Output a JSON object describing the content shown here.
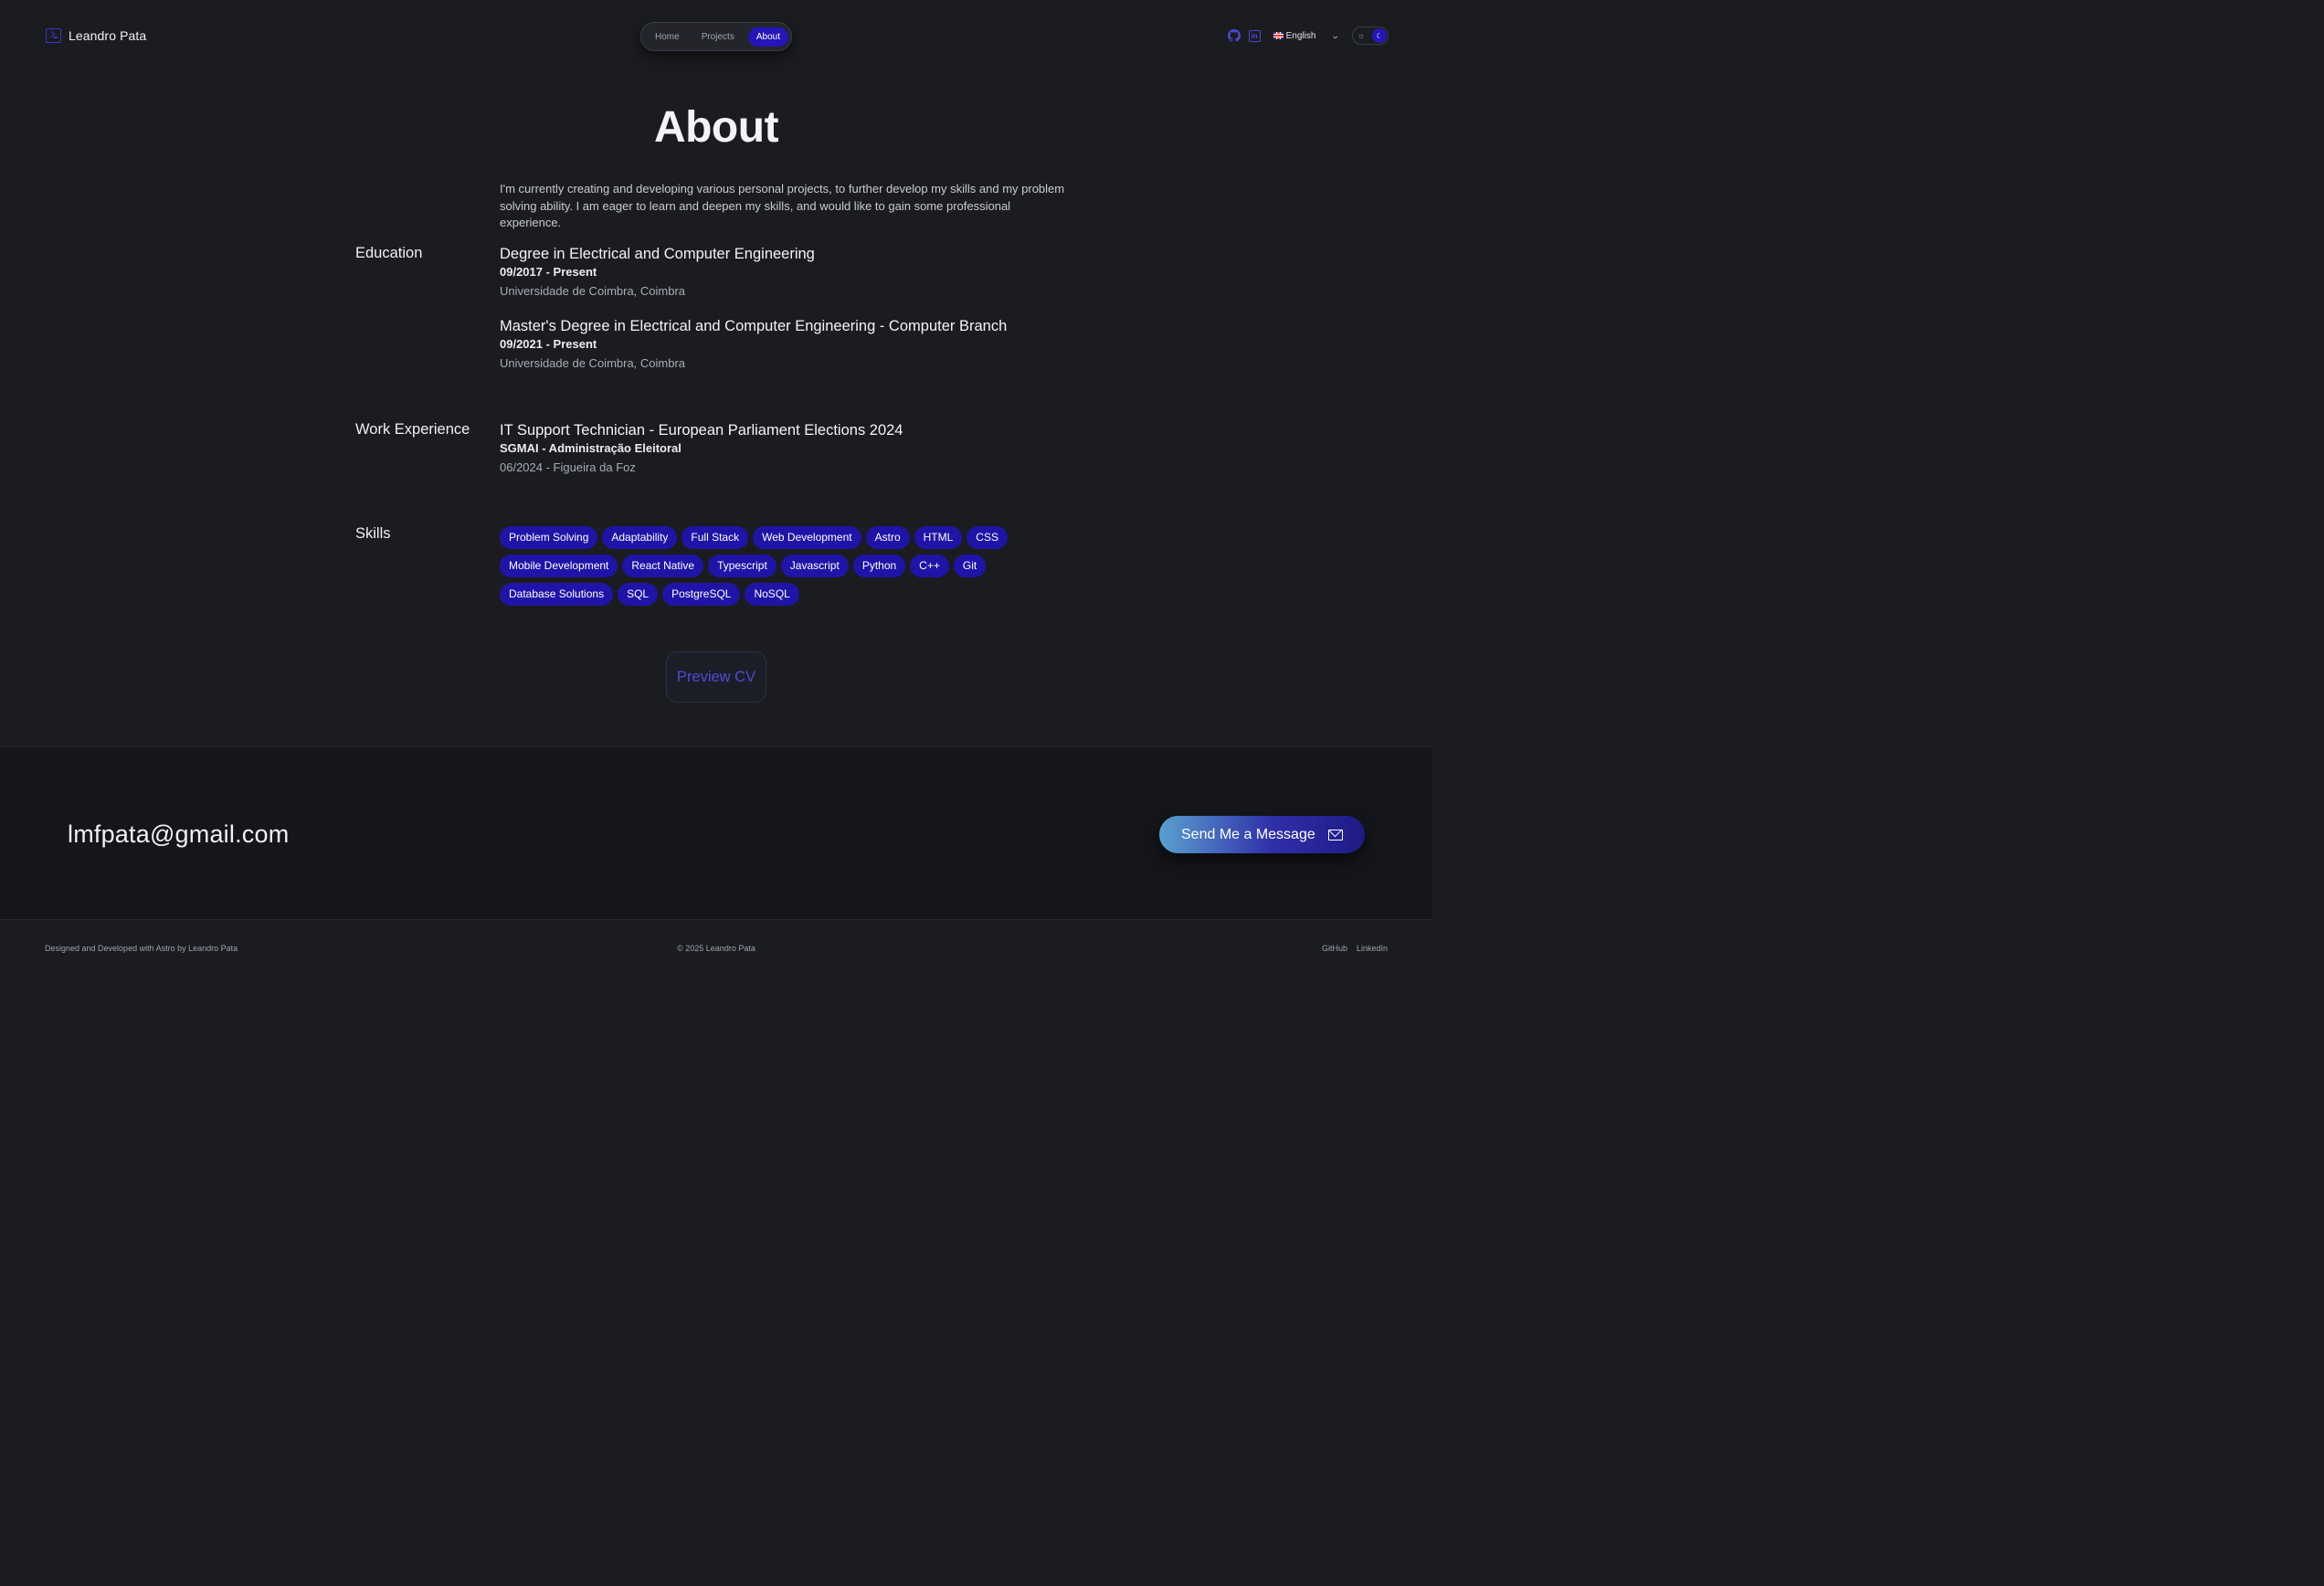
{
  "header": {
    "brand": "Leandro Pata",
    "nav": [
      "Home",
      "Projects",
      "About"
    ],
    "active_nav": "About",
    "language": "English"
  },
  "main": {
    "title": "About",
    "intro": "I'm currently creating and developing various personal projects, to further develop my skills and my problem solving ability. I am eager to learn and deepen my skills, and would like to gain some professional experience.",
    "education": {
      "label": "Education",
      "items": [
        {
          "title": "Degree in Electrical and Computer Engineering",
          "dates": "09/2017 - Present",
          "place": "Universidade de Coimbra, Coimbra"
        },
        {
          "title": "Master's Degree in Electrical and Computer Engineering - Computer Branch",
          "dates": "09/2021 - Present",
          "place": "Universidade de Coimbra, Coimbra"
        }
      ]
    },
    "work": {
      "label": "Work Experience",
      "items": [
        {
          "title": "IT Support Technician - European Parliament Elections 2024",
          "org": "SGMAI - Administração Eleitoral",
          "meta": "06/2024 - Figueira da Foz"
        }
      ]
    },
    "skills": {
      "label": "Skills",
      "rows": [
        [
          "Problem Solving",
          "Adaptability",
          "Full Stack",
          "Web Development",
          "Astro",
          "HTML",
          "CSS"
        ],
        [
          "Mobile Development",
          "React Native",
          "Typescript",
          "Javascript",
          "Python",
          "C++",
          "Git"
        ],
        [
          "Database Solutions",
          "SQL",
          "PostgreSQL",
          "NoSQL"
        ]
      ]
    },
    "cv_button": "Preview CV"
  },
  "contact": {
    "email": "lmfpata@gmail.com",
    "send_button": "Send Me a Message"
  },
  "footer": {
    "left": "Designed and Developed with Astro by Leandro Pata",
    "center": "© 2025 Leandro Pata",
    "links": [
      "GitHub",
      "LinkedIn"
    ]
  },
  "colors": {
    "background": "#1b1c1f",
    "accent": "#2416b8",
    "chip": "#1f14a8"
  },
  "icons": [
    "terminal-logo-icon",
    "github-icon",
    "linkedin-icon",
    "uk-flag-icon",
    "chevron-down-icon",
    "sun-icon",
    "moon-icon",
    "mail-icon"
  ]
}
